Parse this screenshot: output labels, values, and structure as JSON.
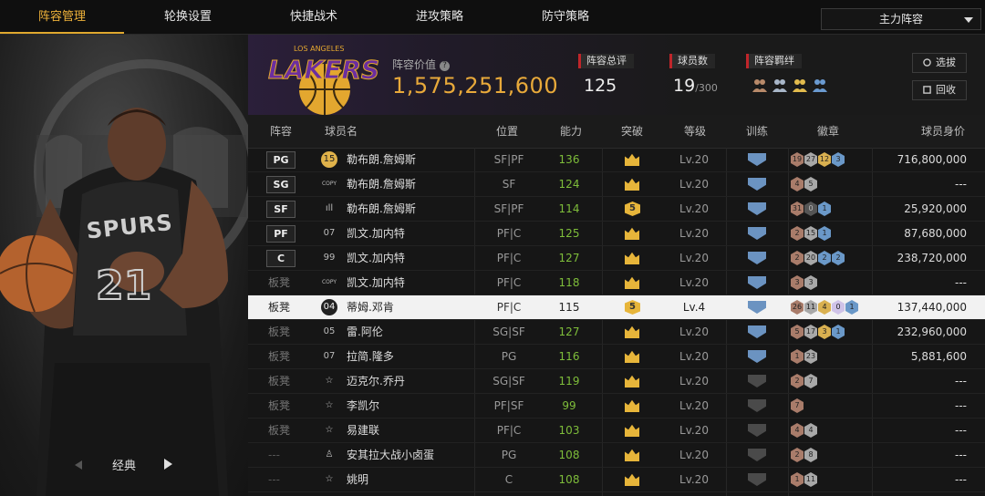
{
  "nav": {
    "tabs": [
      "阵容管理",
      "轮换设置",
      "快捷战术",
      "进攻策略",
      "防守策略"
    ],
    "active_index": 0,
    "lineup_selected": "主力阵容"
  },
  "player_panel": {
    "style_label": "经典"
  },
  "team": {
    "logo_text": "LAKERS",
    "logo_subtext": "LOS ANGELES",
    "value_label": "阵容价值",
    "value": "1,575,251,600",
    "overall_label": "阵容总评",
    "overall": "125",
    "players_label": "球员数",
    "players_count": "19",
    "players_max": "/300",
    "chemistry_label": "阵容羁绊",
    "select_button": "选拔",
    "recycle_button": "回收"
  },
  "table": {
    "headers": {
      "slot": "阵容",
      "name": "球员名",
      "position": "位置",
      "rating": "能力",
      "breakthrough": "突破",
      "level": "等级",
      "training": "训练",
      "badges": "徽章",
      "worth": "球员身价"
    },
    "rows": [
      {
        "slot": "PG",
        "slot_type": "start",
        "num": "15",
        "name": "勒布朗.詹姆斯",
        "pos": "SF|PF",
        "rating": "136",
        "bt": "crown",
        "level": "Lv.20",
        "train": "blue",
        "badges": [
          [
            "bronze",
            "19"
          ],
          [
            "silver",
            "27"
          ],
          [
            "gold",
            "12"
          ],
          [
            "blue",
            "3"
          ]
        ],
        "worth": "716,800,000"
      },
      {
        "slot": "SG",
        "slot_type": "start",
        "num": "COPY",
        "name": "勒布朗.詹姆斯",
        "pos": "SF",
        "rating": "124",
        "bt": "crown",
        "level": "Lv.20",
        "train": "blue",
        "badges": [
          [
            "bronze",
            "4"
          ],
          [
            "silver",
            "5"
          ]
        ],
        "worth": "---"
      },
      {
        "slot": "SF",
        "slot_type": "start",
        "num": "ıll",
        "name": "勒布朗.詹姆斯",
        "pos": "SF|PF",
        "rating": "114",
        "bt": "5",
        "level": "Lv.20",
        "train": "blue",
        "badges": [
          [
            "bronze",
            "31"
          ],
          [
            "dark",
            "0"
          ],
          [
            "blue",
            "1"
          ]
        ],
        "worth": "25,920,000"
      },
      {
        "slot": "PF",
        "slot_type": "start",
        "num": "07",
        "name": "凯文.加内特",
        "pos": "PF|C",
        "rating": "125",
        "bt": "crown",
        "level": "Lv.20",
        "train": "blue",
        "badges": [
          [
            "bronze",
            "2"
          ],
          [
            "silver",
            "15"
          ],
          [
            "blue",
            "1"
          ]
        ],
        "worth": "87,680,000"
      },
      {
        "slot": "C",
        "slot_type": "start",
        "num": "99",
        "name": "凯文.加内特",
        "pos": "PF|C",
        "rating": "127",
        "bt": "crown",
        "level": "Lv.20",
        "train": "blue",
        "badges": [
          [
            "bronze",
            "2"
          ],
          [
            "silver",
            "20"
          ],
          [
            "blue",
            "2"
          ],
          [
            "blue",
            "2"
          ]
        ],
        "worth": "238,720,000"
      },
      {
        "slot": "板凳",
        "slot_type": "bench",
        "num": "COPY",
        "name": "凯文.加内特",
        "pos": "PF|C",
        "rating": "118",
        "bt": "crown",
        "level": "Lv.20",
        "train": "blue",
        "badges": [
          [
            "bronze",
            "3"
          ],
          [
            "silver",
            "3"
          ]
        ],
        "worth": "---"
      },
      {
        "slot": "板凳",
        "slot_type": "bench",
        "num": "04",
        "name": "蒂姆.邓肯",
        "pos": "PF|C",
        "rating": "115",
        "bt": "5",
        "level": "Lv.4",
        "train": "blue",
        "badges": [
          [
            "bronze",
            "26"
          ],
          [
            "silver",
            "11"
          ],
          [
            "gold",
            "4"
          ],
          [
            "purple",
            "0"
          ],
          [
            "blue",
            "1"
          ]
        ],
        "worth": "137,440,000",
        "highlight": true
      },
      {
        "slot": "板凳",
        "slot_type": "bench",
        "num": "05",
        "name": "雷.阿伦",
        "pos": "SG|SF",
        "rating": "127",
        "bt": "crown",
        "level": "Lv.20",
        "train": "blue",
        "badges": [
          [
            "bronze",
            "5"
          ],
          [
            "silver",
            "17"
          ],
          [
            "gold",
            "3"
          ],
          [
            "blue",
            "1"
          ]
        ],
        "worth": "232,960,000"
      },
      {
        "slot": "板凳",
        "slot_type": "bench",
        "num": "07",
        "name": "拉简.隆多",
        "pos": "PG",
        "rating": "116",
        "bt": "crown",
        "level": "Lv.20",
        "train": "blue",
        "badges": [
          [
            "bronze",
            "1"
          ],
          [
            "silver",
            "23"
          ]
        ],
        "worth": "5,881,600"
      },
      {
        "slot": "板凳",
        "slot_type": "bench",
        "num": "☆",
        "name": "迈克尔.乔丹",
        "pos": "SG|SF",
        "rating": "119",
        "bt": "crown",
        "level": "Lv.20",
        "train": "gray",
        "badges": [
          [
            "bronze",
            "2"
          ],
          [
            "silver",
            "7"
          ]
        ],
        "worth": "---"
      },
      {
        "slot": "板凳",
        "slot_type": "bench",
        "num": "☆",
        "name": "李凯尔",
        "pos": "PF|SF",
        "rating": "99",
        "bt": "crown",
        "level": "Lv.20",
        "train": "gray",
        "badges": [
          [
            "bronze",
            "7"
          ]
        ],
        "worth": "---"
      },
      {
        "slot": "板凳",
        "slot_type": "bench",
        "num": "☆",
        "name": "易建联",
        "pos": "PF|C",
        "rating": "103",
        "bt": "crown",
        "level": "Lv.20",
        "train": "gray",
        "badges": [
          [
            "bronze",
            "4"
          ],
          [
            "silver",
            "4"
          ]
        ],
        "worth": "---"
      },
      {
        "slot": "---",
        "slot_type": "none",
        "num": "♙",
        "name": "安其拉大战小卤蛋",
        "pos": "PG",
        "rating": "108",
        "bt": "crown",
        "level": "Lv.20",
        "train": "gray",
        "badges": [
          [
            "bronze",
            "2"
          ],
          [
            "silver",
            "8"
          ]
        ],
        "worth": "---"
      },
      {
        "slot": "---",
        "slot_type": "none",
        "num": "☆",
        "name": "姚明",
        "pos": "C",
        "rating": "108",
        "bt": "crown",
        "level": "Lv.20",
        "train": "gray",
        "badges": [
          [
            "bronze",
            "1"
          ],
          [
            "silver",
            "11"
          ]
        ],
        "worth": "---"
      }
    ]
  },
  "colors": {
    "accent": "#e0a82e",
    "rating_green": "#7ebd3a",
    "highlight_row": "#f2f2f2",
    "stat_marker": "#c0252a"
  }
}
